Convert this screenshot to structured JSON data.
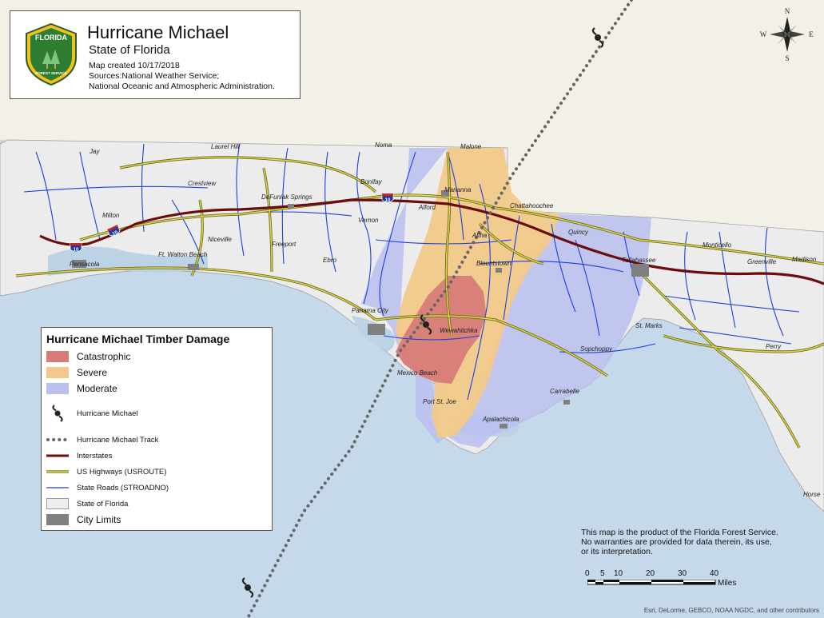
{
  "title": {
    "main": "Hurricane Michael",
    "sub": "State of Florida",
    "created": "Map created 10/17/2018",
    "sources_line1": "Sources:National Weather Service;",
    "sources_line2": "National Oceanic and Atmospheric Administration.",
    "logo_top": "FLORIDA",
    "logo_bottom": "FOREST SERVICE"
  },
  "legend": {
    "title": "Hurricane Michael Timber Damage",
    "items": [
      {
        "label": "Catastrophic",
        "color": "#d77b78"
      },
      {
        "label": "Severe",
        "color": "#f2c98a"
      },
      {
        "label": "Moderate",
        "color": "#b9c0ee"
      },
      {
        "label": "Hurricane Michael",
        "icon": "hurricane-icon"
      },
      {
        "label": "Hurricane Michael Track",
        "icon": "dotted-track"
      },
      {
        "label": "Interstates",
        "color": "#6b0d0d"
      },
      {
        "label": "US Highways (USROUTE)",
        "color": "#c9bb2c"
      },
      {
        "label": "State Roads (STROADNO)",
        "color": "#1a3fe0"
      },
      {
        "label": "State of Florida",
        "color": "#eeeeee"
      },
      {
        "label": "City Limits",
        "color": "#808080"
      }
    ]
  },
  "cities": [
    "Jay",
    "Laurel Hill",
    "Noma",
    "Malone",
    "Crestview",
    "DeFuniak Springs",
    "Bonifay",
    "Marianna",
    "Milton",
    "Alford",
    "Chattahoochee",
    "Vernon",
    "Pensacola",
    "Ft. Walton Beach",
    "Niceville",
    "Freeport",
    "Ebro",
    "Altha",
    "Quincy",
    "Monticello",
    "Madison",
    "Greenville",
    "Tallahassee",
    "Blountstown",
    "Panama City",
    "Wewahitchka",
    "St. Marks",
    "Perry",
    "Sopchoppy",
    "Mexico Beach",
    "Carrabelle",
    "Port St. Joe",
    "Apalachicola",
    "Horse"
  ],
  "interstate_shield": "10",
  "disclaimer": {
    "line1": "This map is the product of the Florida Forest Service.",
    "line2": " No warranties are provided for data therein, its use,",
    "line3": " or its interpretation."
  },
  "scale": {
    "ticks": [
      "0",
      "5",
      "10",
      "20",
      "30",
      "40"
    ],
    "unit": "Miles"
  },
  "compass": {
    "n": "N",
    "s": "S",
    "e": "E",
    "w": "W"
  },
  "credits": "Esri, DeLorme, GEBCO, NOAA NGDC, and other contributors",
  "colors": {
    "water": "#c9dbe9",
    "land": "#eeeeee",
    "out_of_state": "#f4f1ea",
    "catastrophic": "#d77b78",
    "severe": "#f2c98a",
    "moderate": "#b9c0ee",
    "interstate": "#6b0d0d",
    "us_highway": "#c9bb2c",
    "state_road": "#1a3fe0"
  }
}
